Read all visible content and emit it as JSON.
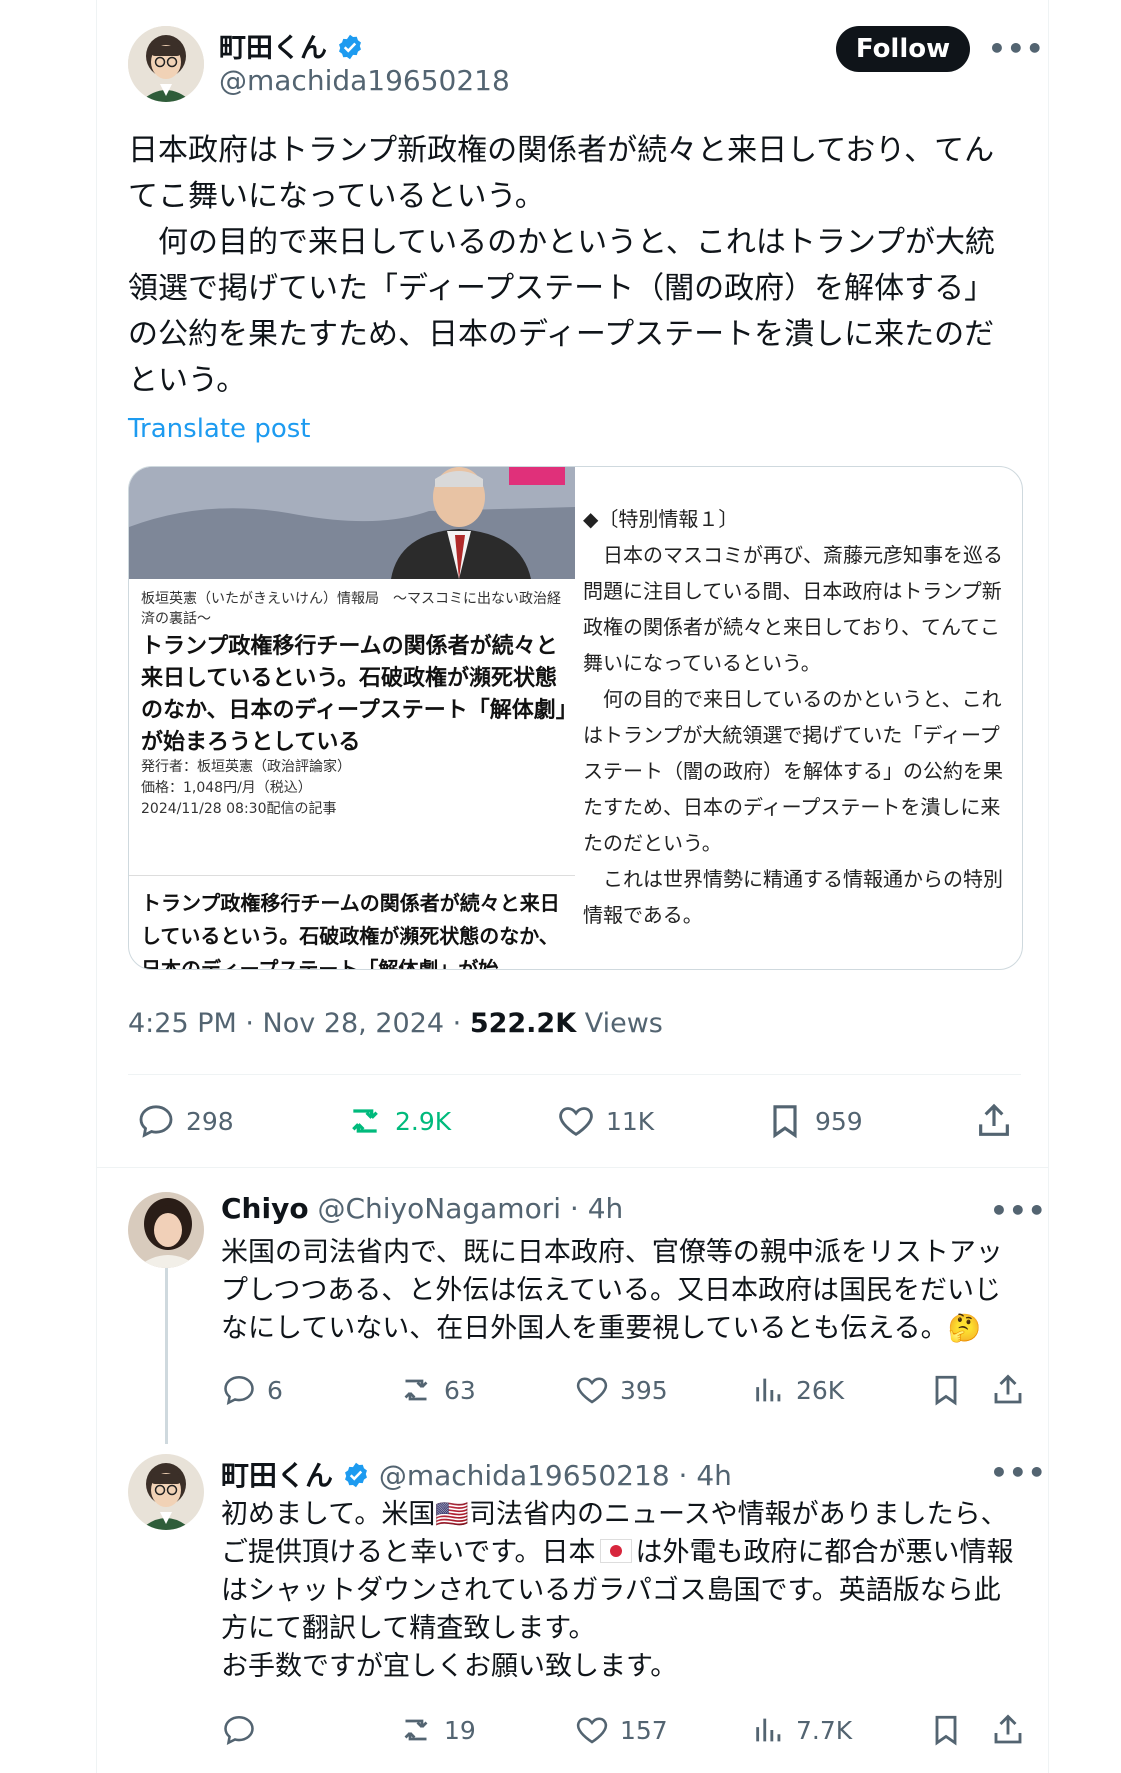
{
  "main_post": {
    "display_name": "町田くん",
    "handle": "@machida19650218",
    "follow_label": "Follow",
    "more_label": "•••",
    "text": "日本政府はトランプ新政権の関係者が続々と来日しており、てんてこ舞いになっているという。\n　何の目的で来日しているのかというと、これはトランプが大統領選で掲げていた「ディープステート（闇の政府）を解体する」の公約を果たすため、日本のディープステートを潰しに来たのだという。",
    "translate_label": "Translate post",
    "time": "4:25 PM · Nov 28, 2024 · ",
    "views_count": "522.2K",
    "views_label": " Views",
    "actions": {
      "replies": "298",
      "reposts": "2.9K",
      "likes": "11K",
      "bookmarks": "959"
    }
  },
  "card": {
    "left": {
      "source": "板垣英憲（いたがきえいけん）情報局　〜マスコミに出ない政治経済の裏話〜",
      "headline": "トランプ政権移行チームの関係者が続々と来日しているという。石破政権が瀕死状態のなか、日本のディープステート「解体劇」が始まろうとしている",
      "publisher": "発行者：板垣英憲（政治評論家）",
      "price": "価格：1,048円/月（税込）",
      "date": "2024/11/28 08:30配信の記事",
      "excerpt": "トランプ政権移行チームの関係者が続々と来日しているという。石破政権が瀕死状態のなか、日本のディープステート「解体劇」が始"
    },
    "right_text": "◆〔特別情報１〕\n　日本のマスコミが再び、斎藤元彦知事を巡る問題に注目している間、日本政府はトランプ新政権の関係者が続々と来日しており、てんてこ舞いになっているという。\n　何の目的で来日しているのかというと、これはトランプが大統領選で掲げていた「ディープステート（闇の政府）を解体する」の公約を果たすため、日本のディープステートを潰しに来たのだという。\n　これは世界情勢に精通する情報通からの特別情報である。"
  },
  "reply1": {
    "display_name": "Chiyo",
    "handle_time": "@ChiyoNagamori · 4h",
    "more_label": "•••",
    "text": "米国の司法省内で、既に日本政府、官僚等の親中派をリストアップしつつある、と外伝は伝えている。又日本政府は国民をだいじなにしていない、在日外国人を重要視しているとも伝える。🤔",
    "actions": {
      "replies": "6",
      "reposts": "63",
      "likes": "395",
      "views": "26K"
    }
  },
  "reply2": {
    "display_name": "町田くん",
    "handle_time": "@machida19650218 · 4h",
    "more_label": "•••",
    "text_part1": "初めまして。米国",
    "flag1": "🇺🇸",
    "text_part2": "司法省内のニュースや情報がありましたら、ご提供頂けると幸いです。日本",
    "text_part3": "は外電も政府に都合が悪い情報はシャットダウンされているガラパゴス島国です。英語版なら此方にて翻訳して精査致します。\nお手数ですが宜しくお願い致します。",
    "actions": {
      "replies": "",
      "reposts": "19",
      "likes": "157",
      "views": "7.7K"
    }
  },
  "colors": {
    "accent": "#1d9bf0",
    "repost_active": "#00ba7c",
    "muted": "#536471",
    "text": "#0f1419"
  }
}
